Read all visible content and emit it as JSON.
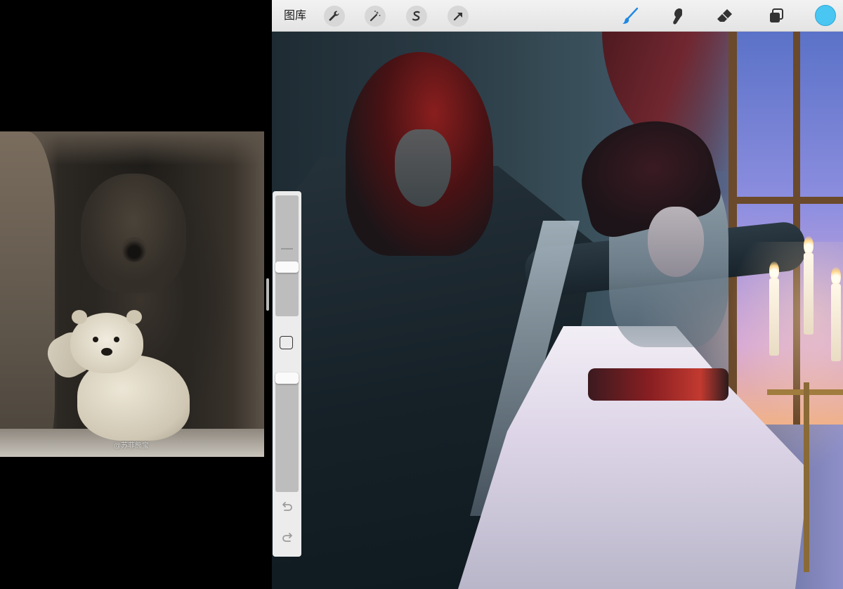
{
  "left_pane": {
    "watermark": "@苏菲熊宝"
  },
  "toolbar": {
    "gallery_label": "图库",
    "icons": [
      "wrench-icon",
      "magic-wand-icon",
      "selection-icon",
      "transform-arrow-icon",
      "brush-icon",
      "smudge-icon",
      "eraser-icon",
      "layers-icon"
    ],
    "active_tool": "brush",
    "brush_color": "#1E88E5",
    "current_color": "#49C6F2"
  },
  "sidebar": {
    "brush_size_level": 0.55,
    "opacity_level": 0.95
  }
}
